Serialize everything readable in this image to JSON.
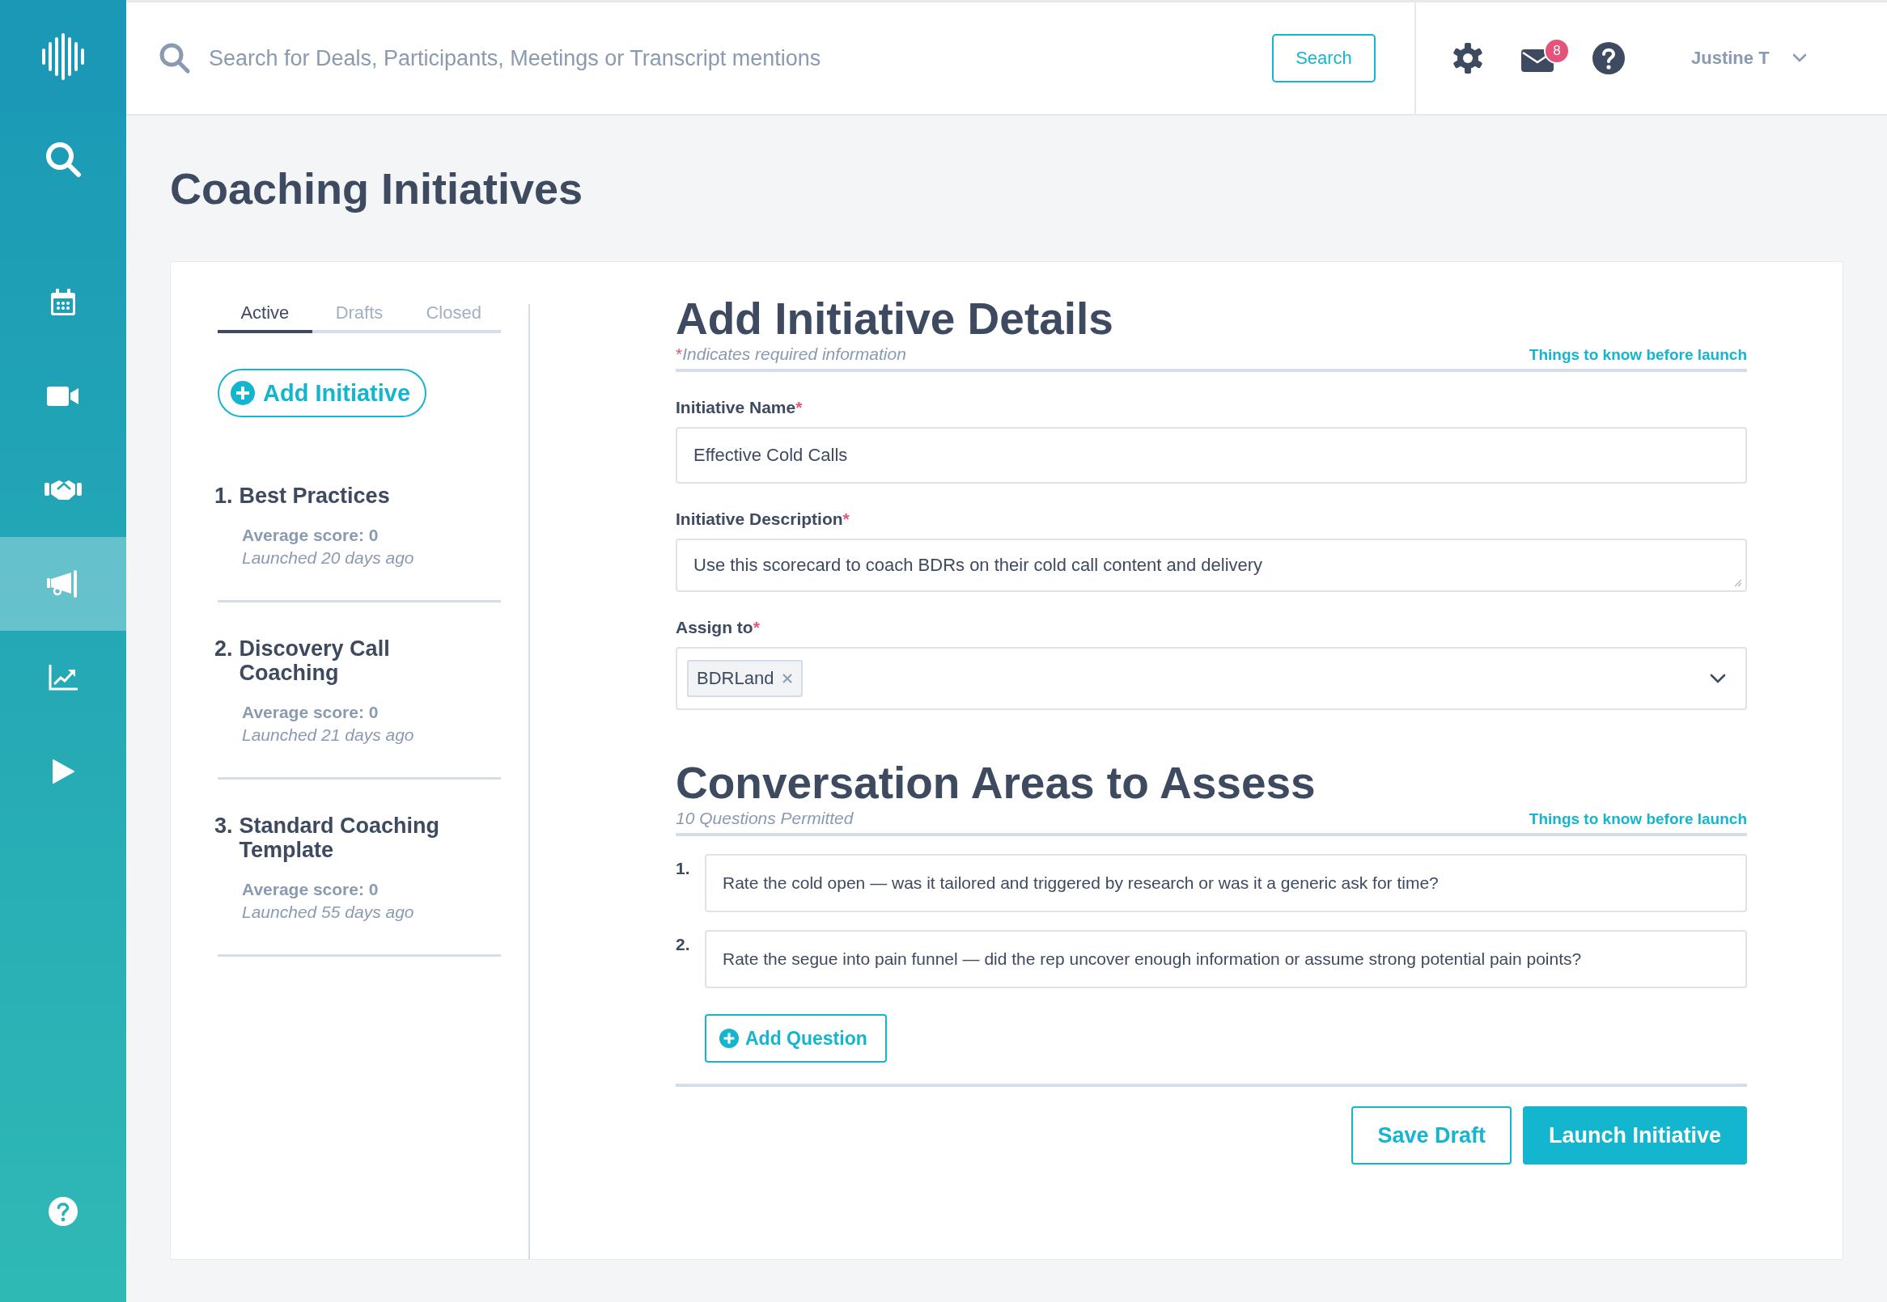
{
  "sidebar": {
    "items": [
      {
        "selected": false
      },
      {
        "selected": false
      },
      {
        "selected": false
      },
      {
        "selected": false
      },
      {
        "selected": true
      },
      {
        "selected": false
      },
      {
        "selected": false
      }
    ]
  },
  "top_bar": {
    "search": {
      "placeholder": "Search for Deals, Participants, Meetings or Transcript mentions"
    },
    "search_button": "Search",
    "mail_badge": "8",
    "user": "Justine T"
  },
  "page_title": "Coaching Initiatives",
  "tabs": [
    {
      "label": "Active",
      "selected": true
    },
    {
      "label": "Drafts",
      "selected": false
    },
    {
      "label": "Closed",
      "selected": false
    }
  ],
  "add_initiative": "Add Initiative",
  "initiatives": [
    {
      "number": "1.",
      "title": "Best Practices",
      "score": "Average score: 0",
      "launched": "Launched 20 days ago"
    },
    {
      "number": "2.",
      "title": "Discovery Call Coaching",
      "score": "Average score: 0",
      "launched": "Launched 21 days ago"
    },
    {
      "number": "3.",
      "title": "Standard Coaching Template",
      "score": "Average score: 0",
      "launched": "Launched 55 days ago"
    }
  ],
  "details": {
    "heading": "Add Initiative Details",
    "required_mark": "*",
    "note": "Indicates required information",
    "link": "Things to know before launch",
    "fields": [
      {
        "kind": "input",
        "label": "Initiative Name",
        "required_mark": "*",
        "value": "Effective Cold Calls"
      },
      {
        "kind": "textarea",
        "label": "Initiative Description",
        "required_mark": "*",
        "value": "Use this scorecard to coach BDRs on their cold call content and delivery"
      },
      {
        "kind": "select",
        "label": "Assign to",
        "required_mark": "*",
        "tags": [
          "BDRLand"
        ]
      }
    ]
  },
  "areas": {
    "heading": "Conversation Areas to Assess",
    "note": "10 Questions Permitted",
    "link": "Things to know before launch",
    "questions": [
      {
        "number": "1.",
        "text": "Rate the cold open — was it tailored and triggered by research or was it a generic ask for time?"
      },
      {
        "number": "2.",
        "text": "Rate the segue into pain funnel — did the rep uncover enough information or assume strong potential pain points?"
      }
    ],
    "add_question": "Add Question"
  },
  "actions": {
    "save_draft": "Save Draft",
    "launch": "Launch Initiative"
  }
}
